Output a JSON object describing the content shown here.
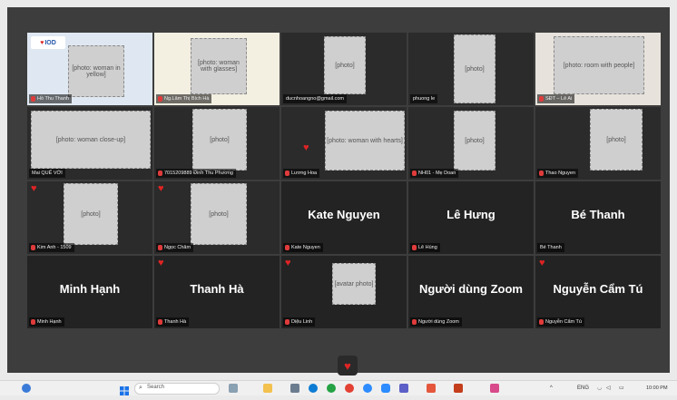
{
  "app": {
    "name": "Zoom"
  },
  "row1": [
    {
      "id": "p1",
      "tag": "Hồ Thu Thanh",
      "logo": "IOD"
    },
    {
      "id": "p2",
      "tag": "Ng.Lâm Thị Bích Hà",
      "active": true
    },
    {
      "id": "p3",
      "tag": "ducnhoangno@gmail.com"
    },
    {
      "id": "p4",
      "tag": "phuong le"
    },
    {
      "id": "p5",
      "tag": "SĐT – Lê Ai"
    }
  ],
  "row2": [
    {
      "id": "p6",
      "tag": "Mai QUẾ VỚI"
    },
    {
      "id": "p7",
      "tag": "7015209889 Đinh Thu Phương"
    },
    {
      "id": "p8",
      "tag": "Lương Hoa"
    },
    {
      "id": "p9",
      "tag": "NH01 - Mẹ Doan"
    },
    {
      "id": "p10",
      "tag": "Thao Nguyen"
    }
  ],
  "row3": [
    {
      "id": "p11",
      "tag": "Kim Anh - 1509"
    },
    {
      "id": "p12",
      "tag": "Ngọc Châm"
    },
    {
      "id": "p13",
      "display": "Kate Nguyen",
      "tag": "Kate Nguyen"
    },
    {
      "id": "p14",
      "display": "Lê Hưng",
      "tag": "Lê Hùng"
    },
    {
      "id": "p15",
      "display": "Bé Thanh",
      "tag": "Bé Thanh"
    }
  ],
  "row4": [
    {
      "id": "p16",
      "display": "Minh Hạnh",
      "tag": "Minh Hạnh"
    },
    {
      "id": "p17",
      "display": "Thanh Hà",
      "tag": "Thanh Hà"
    },
    {
      "id": "p18",
      "tag": "Diệu Linh"
    },
    {
      "id": "p19",
      "display": "Người dùng Zoom",
      "tag": "Người dùng Zoom"
    },
    {
      "id": "p20",
      "display": "Nguyễn Cẩm Tú",
      "tag": "Nguyễn Cẩm Tú"
    }
  ],
  "taskbar": {
    "search_placeholder": "Search",
    "lang": "ENG",
    "time": "10:00 PM"
  },
  "colors": {
    "active_border": "#7ad16f",
    "reaction": "#e02424",
    "window_bg": "#3d3d3d"
  },
  "icons": {
    "reaction": "heart-icon",
    "mic": "mic-off-icon",
    "start": "windows-start-icon",
    "search": "search-icon"
  }
}
